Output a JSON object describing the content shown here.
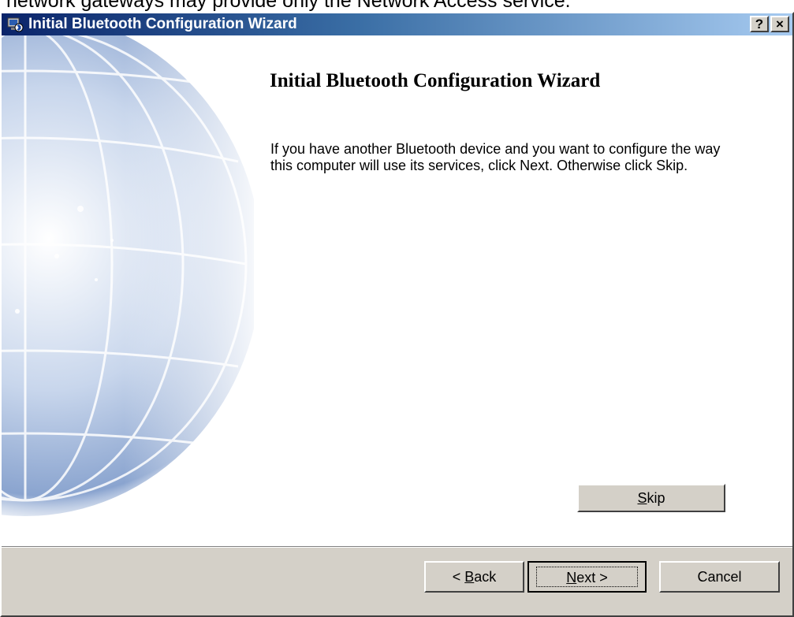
{
  "background_text": "network gateways may provide only the Network Access service.",
  "window": {
    "title": "Initial Bluetooth Configuration Wizard",
    "title_icon": "bluetooth-wizard-icon",
    "help_label": "?",
    "close_label": "×"
  },
  "content": {
    "heading": "Initial Bluetooth Configuration Wizard",
    "description": "If you have another Bluetooth device and you want to configure the way this computer will use its services, click Next. Otherwise click Skip.",
    "skip": {
      "mnemonic": "S",
      "rest": "kip"
    }
  },
  "footer": {
    "back": {
      "prefix": "< ",
      "mnemonic": "B",
      "rest": "ack"
    },
    "next": {
      "prefix": "",
      "mnemonic": "N",
      "rest": "ext >"
    },
    "cancel": "Cancel"
  },
  "colors": {
    "title_gradient_start": "#0a246a",
    "title_gradient_end": "#a6caf0",
    "dialog_face": "#d4d0c8"
  }
}
